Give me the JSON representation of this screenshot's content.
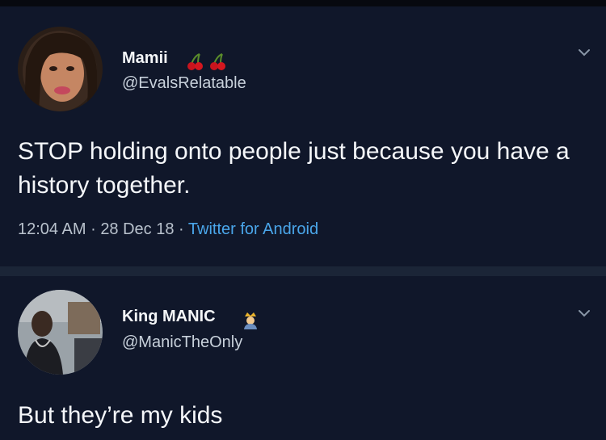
{
  "tweets": [
    {
      "display_name": "Mamii",
      "name_emoji": "cherries-icon",
      "handle": "@EvalsRelatable",
      "text": "STOP holding onto people just because you have a history together.",
      "time": "12:04 AM",
      "date": "28 Dec 18",
      "separator": "·",
      "source": "Twitter for Android"
    },
    {
      "display_name": "King MANIC",
      "name_emoji": "crown-person-icon",
      "handle": "@ManicTheOnly",
      "text": "But they’re my kids"
    }
  ],
  "colors": {
    "background": "#10172a",
    "accent_link": "#4aa6ea",
    "secondary_text": "#b9c2cd"
  }
}
